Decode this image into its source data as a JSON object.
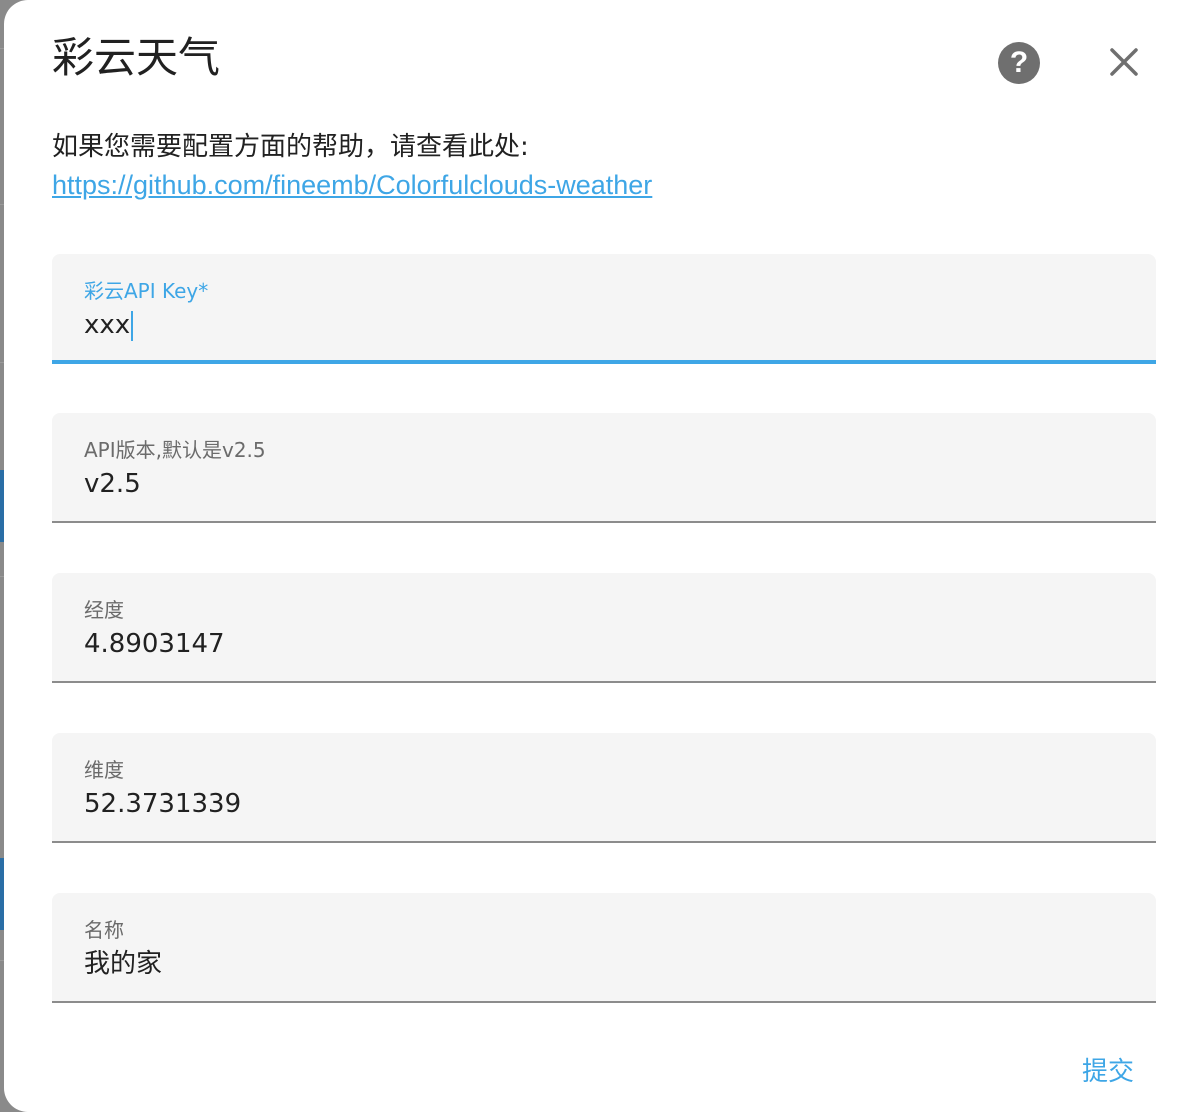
{
  "dialog": {
    "title": "彩云天气",
    "description_text": "如果您需要配置方面的帮助，请查看此处:",
    "help_link": "https://github.com/fineemb/Colorfulclouds-weather",
    "icons": {
      "help": "help-circle-icon",
      "close": "close-icon"
    }
  },
  "fields": {
    "api_key": {
      "label": "彩云API Key*",
      "value": "xxx"
    },
    "api_version": {
      "label": "API版本,默认是v2.5",
      "value": "v2.5"
    },
    "longitude": {
      "label": "经度",
      "value": "4.8903147"
    },
    "latitude": {
      "label": "维度",
      "value": "52.3731339"
    },
    "name": {
      "label": "名称",
      "value": "我的家"
    }
  },
  "actions": {
    "submit_label": "提交"
  },
  "colors": {
    "accent": "#3ea6e6",
    "field_bg": "#f5f5f5",
    "text": "#212121",
    "icon": "#6f6f6f"
  }
}
